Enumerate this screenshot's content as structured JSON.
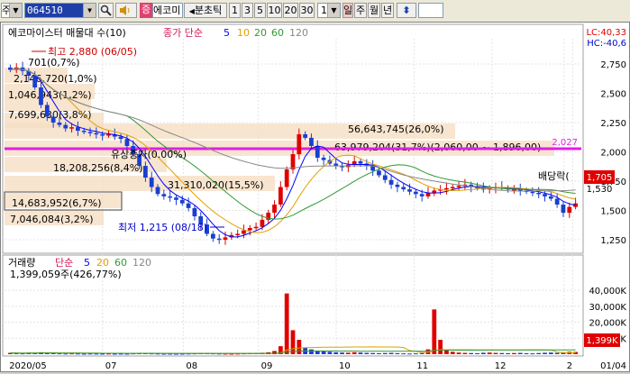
{
  "toolbar": {
    "market_select": "주",
    "stock_code": "064510",
    "search_icon": "magnifier-icon",
    "speaker_icon": "speaker-icon",
    "stock_tag": "증",
    "stock_name": "에코미",
    "period_label": "분초틱",
    "period_buttons": [
      "1",
      "3",
      "5",
      "10",
      "20",
      "30"
    ],
    "interval_value": "1",
    "unit_buttons": [
      "일",
      "주",
      "월",
      "년"
    ],
    "updown_icon": "up-down-arrow-icon"
  },
  "price_panel": {
    "title": "에코마이스터 매물대 수(10)",
    "ma_label": "종가 단순",
    "ma_periods": [
      "5",
      "10",
      "20",
      "60",
      "120"
    ],
    "ma_colors": [
      "#0000ff",
      "#e0a000",
      "#339933",
      "#888888"
    ],
    "top_right_lc": "LC:40,33",
    "top_right_hc": "HC:-40,6",
    "high_label": "최고 2,880 (06/05)",
    "low_label": "최저 1,215 (08/18)",
    "rights_issue_label": "유상증자(0.00%)",
    "dividend_label": "배당락(",
    "hline_label": "2,027",
    "current_price_tag": "1,705",
    "current_price_tag2": "1,530"
  },
  "volume_profile": [
    {
      "label": "701(0,7%)"
    },
    {
      "label": "2,146,720(1,0%)"
    },
    {
      "label": "1,046,943(1,2%)"
    },
    {
      "label": "7,699,630(3,8%)"
    },
    {
      "label": "56,643,745(26,0%)"
    },
    {
      "label": "63,979,204(31,7%)(2,060,00 ~ 1,896,00)"
    },
    {
      "label": "18,208,256(8,4%)"
    },
    {
      "label": "31,310,020(15,5%)"
    },
    {
      "label": "14,683,952(6,7%)"
    },
    {
      "label": "7,046,084(3,2%)"
    }
  ],
  "volume_panel": {
    "title": "거래량",
    "ma_label": "단순",
    "ma_periods": [
      "5",
      "20",
      "60",
      "120"
    ],
    "volume_value": "1,399,059주(426,77%)",
    "current_volume_tag": "1,399K"
  },
  "chart_data": {
    "type": "candlestick",
    "price_axis_ticks": [
      "2,750",
      "2,500",
      "2,250",
      "2,000",
      "1,750",
      "1,500",
      "1,250"
    ],
    "price_ylim": [
      1150,
      2950
    ],
    "hline_value": 2027,
    "volume_axis_ticks": [
      "40,000K",
      "30,000K",
      "20,000K",
      "10,000K"
    ],
    "volume_ylim": [
      0,
      44000
    ],
    "x_ticks": [
      "2020/05",
      "07",
      "08",
      "09",
      "10",
      "11",
      "12",
      "2",
      "01/04"
    ],
    "close_series": [
      2700,
      2720,
      2690,
      2650,
      2550,
      2400,
      2300,
      2250,
      2230,
      2200,
      2210,
      2180,
      2170,
      2160,
      2150,
      2140,
      2150,
      2130,
      2110,
      2050,
      1980,
      1880,
      1780,
      1700,
      1640,
      1620,
      1610,
      1590,
      1560,
      1520,
      1450,
      1380,
      1300,
      1260,
      1250,
      1270,
      1290,
      1300,
      1330,
      1350,
      1360,
      1420,
      1480,
      1550,
      1700,
      1850,
      1980,
      2150,
      2120,
      2050,
      1950,
      1930,
      1900,
      1880,
      1870,
      1890,
      1920,
      1900,
      1880,
      1840,
      1800,
      1760,
      1720,
      1700,
      1680,
      1660,
      1640,
      1620,
      1650,
      1670,
      1680,
      1690,
      1700,
      1710,
      1720,
      1700,
      1690,
      1680,
      1690,
      1700,
      1690,
      1680,
      1680,
      1670,
      1660,
      1650,
      1640,
      1620,
      1600,
      1550,
      1480,
      1530,
      1560
    ],
    "volume_series": [
      800,
      600,
      500,
      900,
      700,
      1200,
      900,
      600,
      500,
      400,
      500,
      400,
      300,
      400,
      350,
      300,
      400,
      300,
      350,
      300,
      500,
      800,
      600,
      500,
      400,
      300,
      300,
      250,
      300,
      400,
      500,
      600,
      700,
      500,
      400,
      350,
      300,
      400,
      500,
      600,
      700,
      900,
      1200,
      2000,
      5000,
      38000,
      15000,
      9000,
      4000,
      3000,
      2000,
      1800,
      1500,
      1200,
      1000,
      900,
      1200,
      1000,
      800,
      700,
      600,
      700,
      800,
      600,
      500,
      400,
      500,
      700,
      3000,
      28000,
      9000,
      2500,
      1500,
      1000,
      800,
      700,
      600,
      900,
      1000,
      800,
      700,
      600,
      700,
      800,
      600,
      500,
      700,
      900,
      1000,
      800,
      1200,
      1500,
      1399
    ]
  }
}
